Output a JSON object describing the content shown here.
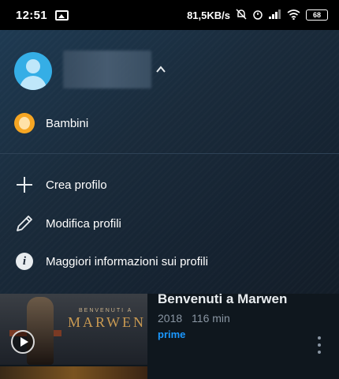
{
  "status_bar": {
    "time": "12:51",
    "network_speed": "81,5KB/s",
    "battery": "68",
    "icons": [
      "image-notification-icon",
      "mute-icon",
      "alarm-icon",
      "signal-icon",
      "wifi-icon",
      "battery-icon"
    ]
  },
  "drawer": {
    "current_profile_avatar": "user-avatar-icon",
    "profiles": [
      {
        "label": "Bambini",
        "icon": "kid-profile-icon"
      }
    ],
    "actions": [
      {
        "label": "Crea profilo",
        "icon": "plus-icon"
      },
      {
        "label": "Modifica profili",
        "icon": "pencil-icon"
      },
      {
        "label": "Maggiori informazioni sui profili",
        "icon": "info-icon"
      }
    ]
  },
  "content": {
    "movie": {
      "title": "Benvenuti a Marwen",
      "year": "2018",
      "duration": "116 min",
      "badge": "prime",
      "thumbnail_title": "MARWEN",
      "thumbnail_subtitle": "BENVENUTI A"
    }
  },
  "colors": {
    "prime_blue": "#1a98ff",
    "avatar_blue": "#35aee6",
    "kid_orange": "#f6a623",
    "drawer_bg": "#1a2b3b"
  }
}
